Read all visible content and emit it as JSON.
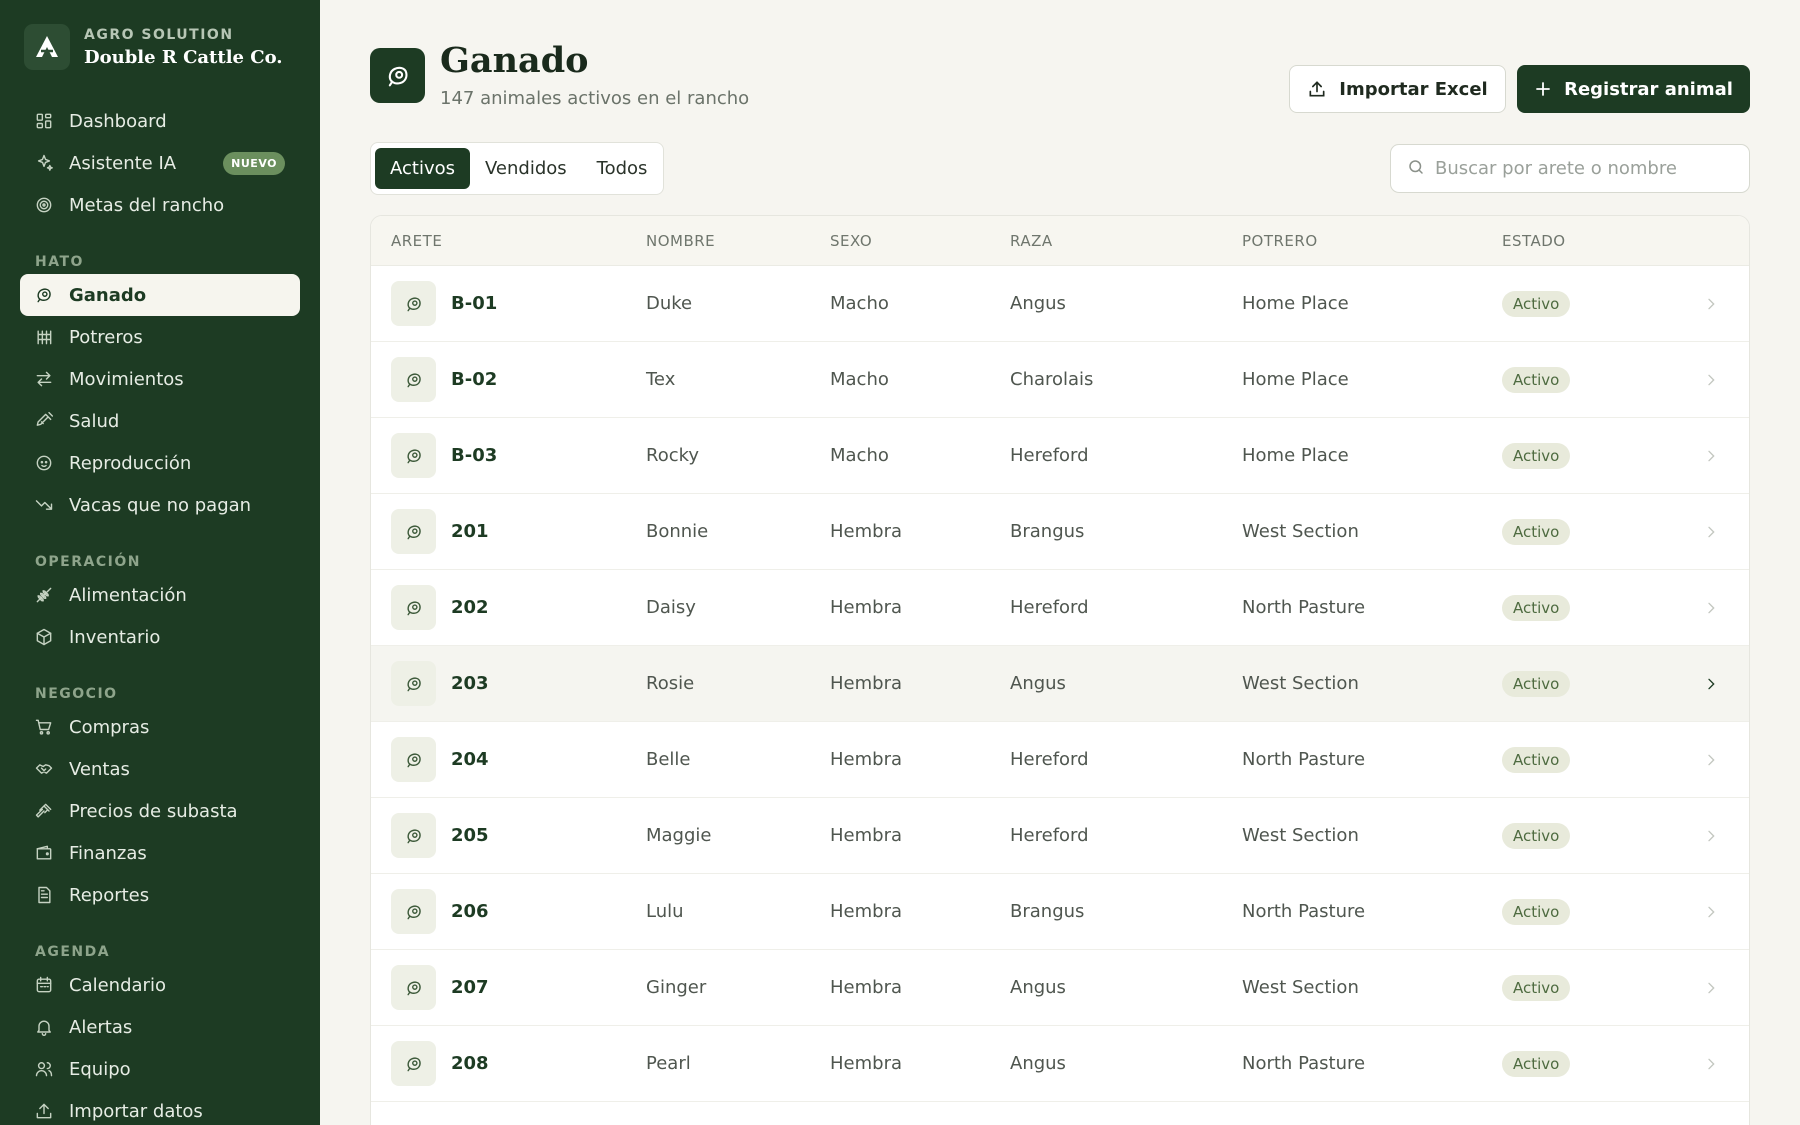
{
  "brand": {
    "subtitle": "AGRO SOLUTION",
    "name": "Double R Cattle Co."
  },
  "sidebar": {
    "top": [
      {
        "label": "Dashboard",
        "icon": "dashboard-icon"
      },
      {
        "label": "Asistente IA",
        "icon": "sparkles-icon",
        "badge": "NUEVO"
      },
      {
        "label": "Metas del rancho",
        "icon": "target-icon"
      }
    ],
    "sections": [
      {
        "title": "HATO",
        "items": [
          {
            "label": "Ganado",
            "icon": "cattle-icon",
            "active": true
          },
          {
            "label": "Potreros",
            "icon": "fence-icon"
          },
          {
            "label": "Movimientos",
            "icon": "arrows-icon"
          },
          {
            "label": "Salud",
            "icon": "syringe-icon"
          },
          {
            "label": "Reproducción",
            "icon": "baby-icon"
          },
          {
            "label": "Vacas que no pagan",
            "icon": "trending-down-icon"
          }
        ]
      },
      {
        "title": "OPERACIÓN",
        "items": [
          {
            "label": "Alimentación",
            "icon": "wheat-icon"
          },
          {
            "label": "Inventario",
            "icon": "package-icon"
          }
        ]
      },
      {
        "title": "NEGOCIO",
        "items": [
          {
            "label": "Compras",
            "icon": "cart-icon"
          },
          {
            "label": "Ventas",
            "icon": "handshake-icon"
          },
          {
            "label": "Precios de subasta",
            "icon": "gavel-icon"
          },
          {
            "label": "Finanzas",
            "icon": "wallet-icon"
          },
          {
            "label": "Reportes",
            "icon": "report-icon"
          }
        ]
      },
      {
        "title": "AGENDA",
        "items": [
          {
            "label": "Calendario",
            "icon": "calendar-icon"
          },
          {
            "label": "Alertas",
            "icon": "bell-icon"
          },
          {
            "label": "Equipo",
            "icon": "users-icon"
          },
          {
            "label": "Importar datos",
            "icon": "upload-icon"
          }
        ]
      }
    ]
  },
  "header": {
    "title": "Ganado",
    "subtitle": "147 animales activos en el rancho",
    "import_label": "Importar Excel",
    "register_label": "Registrar animal"
  },
  "tabs": [
    {
      "label": "Activos",
      "active": true
    },
    {
      "label": "Vendidos"
    },
    {
      "label": "Todos"
    }
  ],
  "search": {
    "placeholder": "Buscar por arete o nombre",
    "value": ""
  },
  "table": {
    "columns": [
      "ARETE",
      "NOMBRE",
      "SEXO",
      "RAZA",
      "POTRERO",
      "ESTADO"
    ],
    "rows": [
      {
        "tag": "B-01",
        "name": "Duke",
        "sex": "Macho",
        "breed": "Angus",
        "pasture": "Home Place",
        "status": "Activo"
      },
      {
        "tag": "B-02",
        "name": "Tex",
        "sex": "Macho",
        "breed": "Charolais",
        "pasture": "Home Place",
        "status": "Activo"
      },
      {
        "tag": "B-03",
        "name": "Rocky",
        "sex": "Macho",
        "breed": "Hereford",
        "pasture": "Home Place",
        "status": "Activo"
      },
      {
        "tag": "201",
        "name": "Bonnie",
        "sex": "Hembra",
        "breed": "Brangus",
        "pasture": "West Section",
        "status": "Activo"
      },
      {
        "tag": "202",
        "name": "Daisy",
        "sex": "Hembra",
        "breed": "Hereford",
        "pasture": "North Pasture",
        "status": "Activo"
      },
      {
        "tag": "203",
        "name": "Rosie",
        "sex": "Hembra",
        "breed": "Angus",
        "pasture": "West Section",
        "status": "Activo",
        "hover": true
      },
      {
        "tag": "204",
        "name": "Belle",
        "sex": "Hembra",
        "breed": "Hereford",
        "pasture": "North Pasture",
        "status": "Activo"
      },
      {
        "tag": "205",
        "name": "Maggie",
        "sex": "Hembra",
        "breed": "Hereford",
        "pasture": "West Section",
        "status": "Activo"
      },
      {
        "tag": "206",
        "name": "Lulu",
        "sex": "Hembra",
        "breed": "Brangus",
        "pasture": "North Pasture",
        "status": "Activo"
      },
      {
        "tag": "207",
        "name": "Ginger",
        "sex": "Hembra",
        "breed": "Angus",
        "pasture": "West Section",
        "status": "Activo"
      },
      {
        "tag": "208",
        "name": "Pearl",
        "sex": "Hembra",
        "breed": "Angus",
        "pasture": "North Pasture",
        "status": "Activo"
      }
    ]
  },
  "colors": {
    "sidebar": "#1d3b23",
    "accent": "#1d3b23",
    "badge": "#6b8f5e",
    "status_bg": "#e8eadb",
    "status_text": "#4e6b40",
    "background": "#f6f5f0"
  }
}
